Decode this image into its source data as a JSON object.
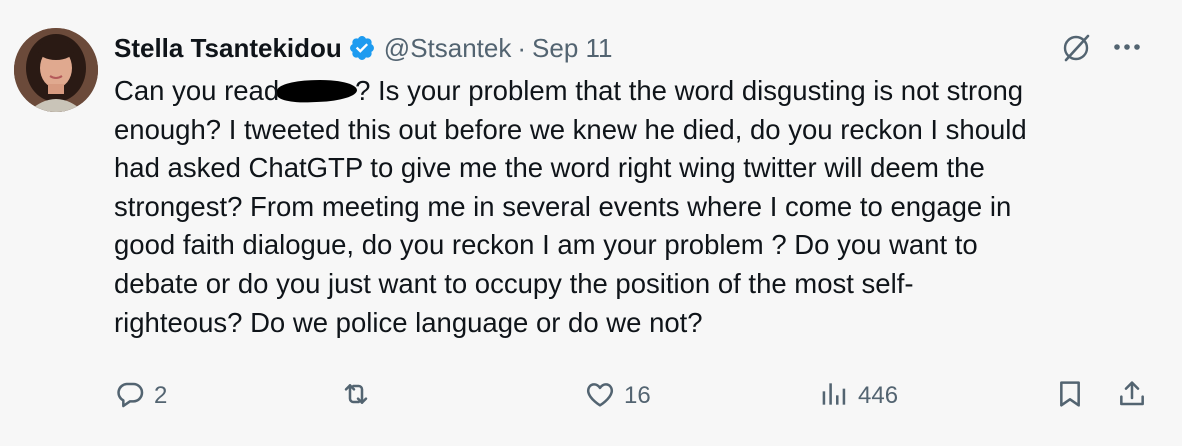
{
  "author": {
    "display_name": "Stella Tsantekidou",
    "handle": "@Stsantek",
    "separator": "·",
    "date": "Sep 11",
    "verified": true
  },
  "tweet": {
    "text_before_redaction": "Can you read",
    "text_after_redaction": "? Is your problem that the word disgusting is not strong\nenough? I tweeted this out before we knew he died, do you reckon I should\nhad asked ChatGTP to give me the word right wing twitter will deem the\nstrongest? From meeting me in several events where I come to engage in\ngood faith dialogue, do you reckon I am your problem ? Do you want to\ndebate or do you just want to occupy the position of the most self-\nrighteous? Do we police language or do we not?"
  },
  "actions": {
    "reply_count": "2",
    "retweet_count": "",
    "like_count": "16",
    "views_count": "446"
  },
  "icons": {
    "reply": "reply-icon",
    "retweet": "retweet-icon",
    "like": "heart-icon",
    "views": "views-icon",
    "bookmark": "bookmark-icon",
    "share": "share-icon",
    "grok": "grok-icon",
    "more": "more-icon"
  },
  "colors": {
    "background": "#f7f7f7",
    "text": "#0f1419",
    "secondary": "#536471",
    "verified": "#1d9bf0"
  }
}
